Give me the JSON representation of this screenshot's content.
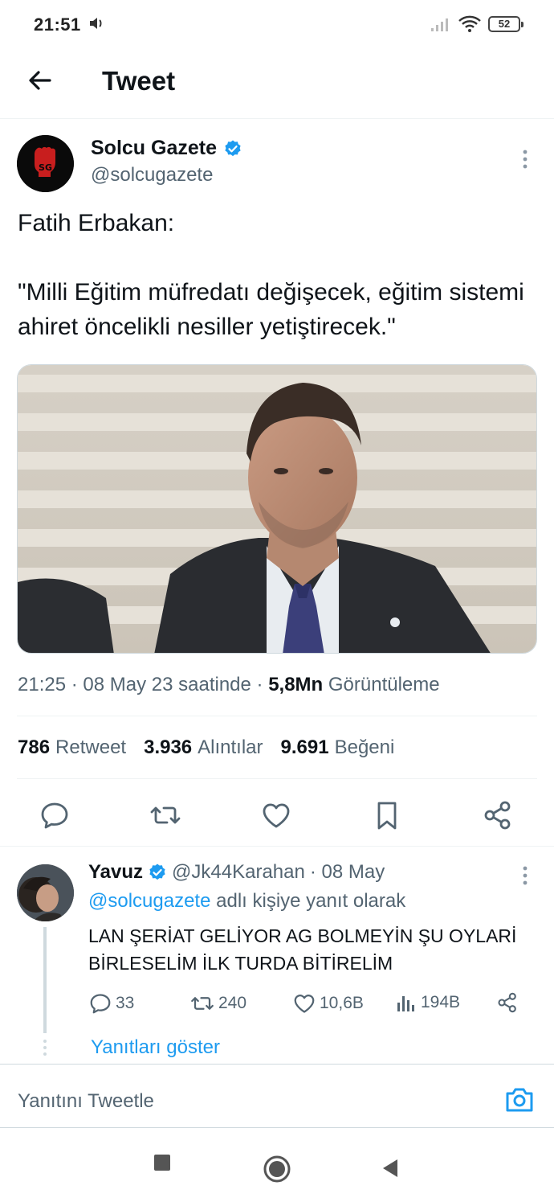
{
  "status_bar": {
    "time": "21:51",
    "battery": "52"
  },
  "header": {
    "title": "Tweet"
  },
  "tweet": {
    "author_name": "Solcu Gazete",
    "author_handle": "@solcugazete",
    "avatar_text": "SG",
    "text": "Fatih Erbakan:\n\n\"Milli Eğitim müfredatı değişecek, eğitim sistemi ahiret öncelikli nesiller yetiştirecek.\"",
    "time_date": "21:25 · 08 May 23 saatinde · ",
    "views_count": "5,8Mn",
    "views_label": "Görüntüleme",
    "stats": [
      {
        "count": "786",
        "label": "Retweet"
      },
      {
        "count": "3.936",
        "label": "Alıntılar"
      },
      {
        "count": "9.691",
        "label": "Beğeni"
      }
    ]
  },
  "reply": {
    "name": "Yavuz",
    "handle": "@Jk44Karahan",
    "date": "· 08 May",
    "reply_to_mention": "@solcugazete",
    "reply_to_suffix": "adlı kişiye yanıt olarak",
    "text": "LAN ŞERİAT GELİYOR AG BOLMEYİN ŞU OYLARİ BİRLESELİM İLK TURDA BİTİRELİM",
    "counts": {
      "replies": "33",
      "retweets": "240",
      "likes": "10,6B",
      "views": "194B"
    },
    "show_replies": "Yanıtları göster"
  },
  "compose": {
    "placeholder": "Yanıtını Tweetle"
  },
  "colors": {
    "accent": "#1d9bf0",
    "text_primary": "#0f1419",
    "text_secondary": "#536471",
    "border": "#eff3f4"
  }
}
